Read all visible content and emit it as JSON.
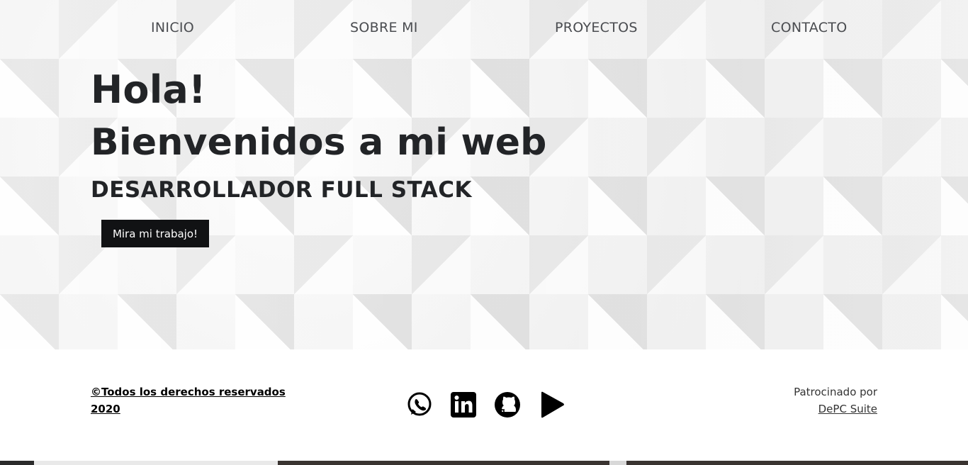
{
  "nav": {
    "items": [
      "INICIO",
      "SOBRE MI",
      "PROYECTOS",
      "CONTACTO"
    ]
  },
  "hero": {
    "greeting": "Hola!",
    "welcome": "Bienvenidos a mi web",
    "role": "DESARROLLADOR FULL STACK",
    "cta_label": "Mira mi trabajo!"
  },
  "footer": {
    "copyright_line1": "©Todos los derechos reservados",
    "copyright_line2": "2020",
    "social_icons": [
      "whatsapp-icon",
      "linkedin-icon",
      "github-icon",
      "play-icon"
    ],
    "sponsor_text": "Patrocinado por",
    "sponsor_link": "DePC Suite"
  },
  "colors": {
    "text_dark": "#222427",
    "button_bg": "#111214",
    "button_text": "#ffffff"
  }
}
